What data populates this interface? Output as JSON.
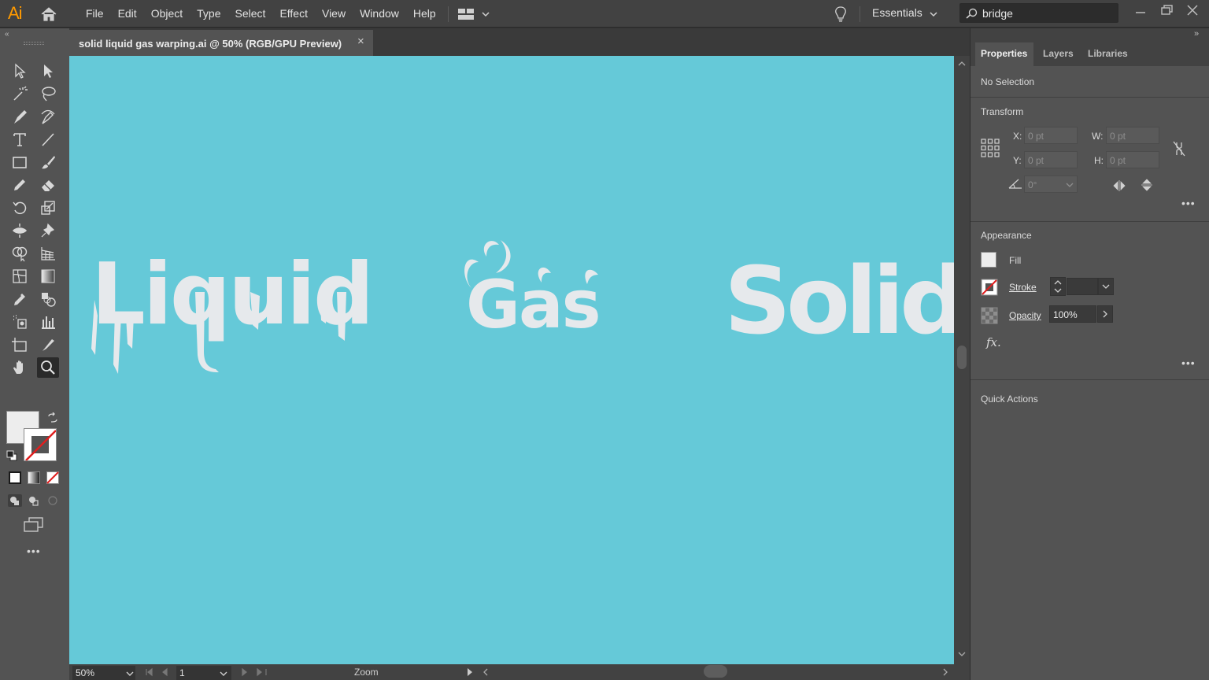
{
  "app": {
    "logo": "Ai"
  },
  "menu": [
    "File",
    "Edit",
    "Object",
    "Type",
    "Select",
    "Effect",
    "View",
    "Window",
    "Help"
  ],
  "workspace": {
    "label": "Essentials"
  },
  "search": {
    "value": "bridge"
  },
  "document": {
    "tab_title": "solid liquid gas warping.ai @ 50% (RGB/GPU Preview)",
    "close": "×"
  },
  "artwork": {
    "words": [
      "Liquid",
      "Gas",
      "Solid"
    ],
    "canvas_color": "#65c9d8",
    "text_color": "#e6e9ec"
  },
  "status": {
    "zoom": "50%",
    "page": "1",
    "tool_label": "Zoom"
  },
  "panel": {
    "tabs": [
      "Properties",
      "Layers",
      "Libraries"
    ],
    "selection": "No Selection",
    "transform": {
      "title": "Transform",
      "x_label": "X:",
      "y_label": "Y:",
      "w_label": "W:",
      "h_label": "H:",
      "x": "0 pt",
      "y": "0 pt",
      "w": "0 pt",
      "h": "0 pt",
      "angle": "0°"
    },
    "appearance": {
      "title": "Appearance",
      "fill": "Fill",
      "stroke": "Stroke",
      "opacity_label": "Opacity",
      "opacity": "100%",
      "fx": "fx."
    },
    "quick_actions": "Quick Actions"
  },
  "toolbar": {
    "more": "•••"
  }
}
